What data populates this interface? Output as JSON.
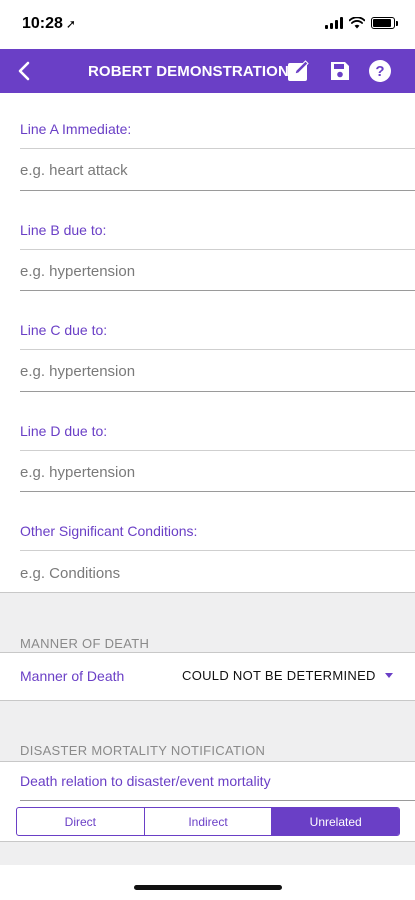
{
  "status_bar": {
    "time": "10:28",
    "location_glyph": "➚",
    "battery_level": 0.9
  },
  "header": {
    "title": "ROBERT DEMONSTRATION",
    "background_color": "#6a3fc6",
    "icons": [
      "back-chevron-icon",
      "edit-note-icon",
      "save-disk-icon",
      "help-icon"
    ]
  },
  "cause_fields": [
    {
      "label": "Line A Immediate:",
      "placeholder": "e.g. heart attack",
      "value": ""
    },
    {
      "label": "Line B due to:",
      "placeholder": "e.g. hypertension",
      "value": ""
    },
    {
      "label": "Line C due to:",
      "placeholder": "e.g. hypertension",
      "value": ""
    },
    {
      "label": "Line D due to:",
      "placeholder": "e.g. hypertension",
      "value": ""
    },
    {
      "label": "Other Significant Conditions:",
      "placeholder": "e.g. Conditions",
      "value": ""
    }
  ],
  "manner_section": {
    "title": "MANNER OF DEATH",
    "label": "Manner of Death",
    "selected": "COULD NOT BE DETERMINED"
  },
  "disaster_section": {
    "title": "DISASTER MORTALITY NOTIFICATION",
    "question": "Death relation to disaster/event mortality",
    "options": [
      "Direct",
      "Indirect",
      "Unrelated"
    ],
    "selected": "Unrelated"
  },
  "colors": {
    "accent": "#6a3fc6",
    "section_background": "#efeff0",
    "placeholder": "#7a7a7a"
  }
}
